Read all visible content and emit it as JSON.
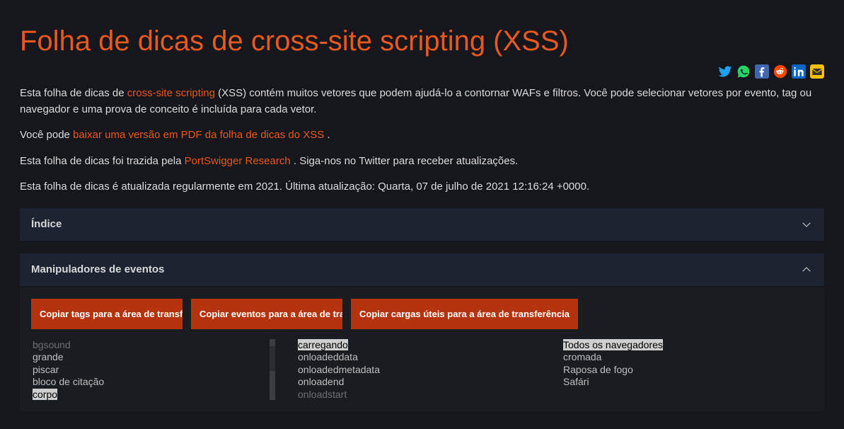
{
  "title": "Folha de dicas de cross-site scripting (XSS)",
  "intro": {
    "p1a": "Esta folha de dicas de ",
    "p1_link": "cross-site scripting",
    "p1b": " (XSS) contém muitos vetores que podem ajudá-lo a contornar WAFs e filtros. Você pode selecionar vetores por evento, tag ou navegador e uma prova de conceito é incluída para cada vetor.",
    "p2a": "Você pode ",
    "p2_link": "baixar uma versão em PDF da folha de dicas do XSS",
    "p2b": " .",
    "p3a": "Esta folha de dicas foi trazida pela ",
    "p3_link": "PortSwigger Research",
    "p3b": " . Siga-nos no Twitter para receber atualizações.",
    "p4": "Esta folha de dicas é atualizada regularmente em 2021. Última atualização: Quarta, 07 de julho de 2021 12:16:24 +0000."
  },
  "accordion1": {
    "title": "Índice"
  },
  "accordion2": {
    "title": "Manipuladores de eventos"
  },
  "buttons": {
    "copy_tags": "Copiar tags para a área de transferência",
    "copy_events": "Copiar eventos para a área de transferência",
    "copy_payloads": "Copiar cargas úteis para a área de transferência"
  },
  "list_tags": {
    "i0": "bgsound",
    "i1": "grande",
    "i2": "piscar",
    "i3": "bloco de citação",
    "i4": "corpo"
  },
  "list_events": {
    "i0": "carregando",
    "i1": "onloadeddata",
    "i2": "onloadedmetadata",
    "i3": "onloadend",
    "i4": "onloadstart"
  },
  "list_browsers": {
    "i0": "Todos os navegadores",
    "i1": "cromada",
    "i2": "Raposa de fogo",
    "i3": "Safári"
  }
}
